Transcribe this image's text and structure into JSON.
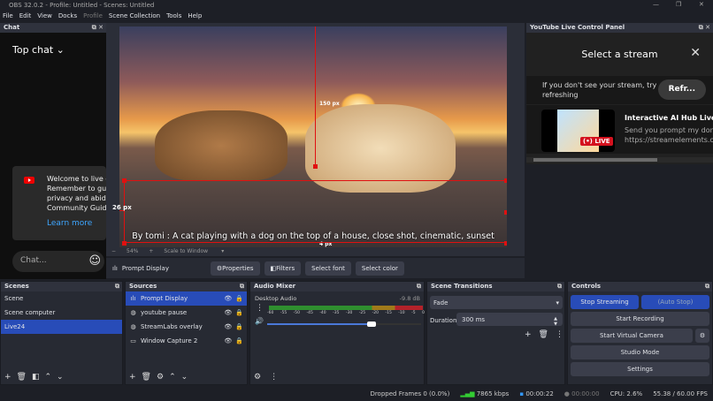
{
  "window": {
    "title": "OBS 32.0.2 - Profile: Untitled - Scenes: Untitled"
  },
  "menu": [
    "File",
    "Edit",
    "View",
    "Docks",
    "Profile",
    "Scene Collection",
    "Tools",
    "Help"
  ],
  "chat": {
    "title": "Chat",
    "dropdown": "Top chat",
    "welcome": "Welcome to live cl\nRemember to gua\nprivacy and abide\nCommunity Guide",
    "learn_more": "Learn more",
    "placeholder": "Chat..."
  },
  "preview": {
    "caption": "By tomi : A cat playing with a dog on the top of a house, close shot, cinematic, sunset",
    "top_px": "150 px",
    "left_px": "26 px",
    "bottom_px": "4 px",
    "zoom": "54%",
    "scale": "Scale to Window"
  },
  "source_toolbar": {
    "source": "Prompt Display",
    "properties": "Properties",
    "filters": "Filters",
    "select_font": "Select font",
    "select_color": "Select color"
  },
  "youtube": {
    "title": "YouTube Live Control Panel",
    "heading": "Select a stream",
    "note": "If you don't see your stream, try\nrefreshing",
    "refresh": "Refr...",
    "stream_title": "Interactive AI Hub Live St",
    "stream_desc": "Send you prompt my donat\nhttps://streamelements.co",
    "live": "LIVE"
  },
  "scenes": {
    "title": "Scenes",
    "items": [
      "Scene",
      "Scene computer",
      "Live24"
    ],
    "selected": 2
  },
  "sources": {
    "title": "Sources",
    "items": [
      "Prompt Display",
      "youtube pause",
      "StreamLabs overlay",
      "Window Capture 2"
    ]
  },
  "audio": {
    "title": "Audio Mixer",
    "channel": "Desktop Audio",
    "level": "-9.8 dB",
    "ticks": [
      "-60",
      "-55",
      "-50",
      "-45",
      "-40",
      "-35",
      "-30",
      "-25",
      "-20",
      "-15",
      "-10",
      "-5",
      "0"
    ],
    "volume": 0.68
  },
  "transitions": {
    "title": "Scene Transitions",
    "type": "Fade",
    "duration_label": "Duration",
    "duration": "300 ms"
  },
  "controls": {
    "title": "Controls",
    "stop_streaming": "Stop Streaming",
    "auto_stop": "(Auto Stop)",
    "start_recording": "Start Recording",
    "start_virtual_camera": "Start Virtual Camera",
    "studio_mode": "Studio Mode",
    "settings": "Settings"
  },
  "status": {
    "dropped": "Dropped Frames 0 (0.0%)",
    "bitrate": "7865 kbps",
    "stream_time": "00:00:22",
    "rec_time": "00:00:00",
    "cpu": "CPU: 2.6%",
    "fps": "55.38 / 60.00 FPS"
  }
}
